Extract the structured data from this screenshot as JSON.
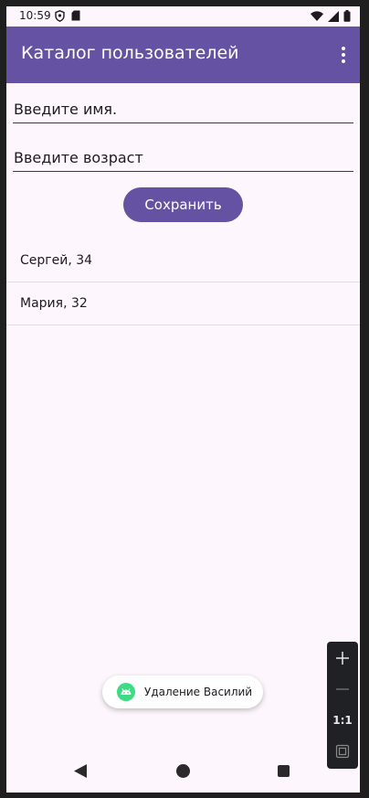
{
  "status_bar": {
    "time": "10:59",
    "icons": [
      "shield-icon",
      "sd-card-icon",
      "wifi-icon",
      "signal-icon",
      "battery-icon"
    ]
  },
  "app_bar": {
    "title": "Каталог пользователей",
    "overflow_icon": "more-vert-icon"
  },
  "form": {
    "name_placeholder": "Введите имя.",
    "age_placeholder": "Введите возраст",
    "save_label": "Сохранить"
  },
  "users": [
    {
      "label": "Сергей, 34"
    },
    {
      "label": "Мария, 32"
    }
  ],
  "toast": {
    "text": "Удаление Василий",
    "icon": "android-icon"
  },
  "zoom_panel": {
    "reset_label": "1:1"
  },
  "colors": {
    "primary": "#6652a2",
    "background": "#fdf7fd",
    "text": "#1d1b20"
  }
}
